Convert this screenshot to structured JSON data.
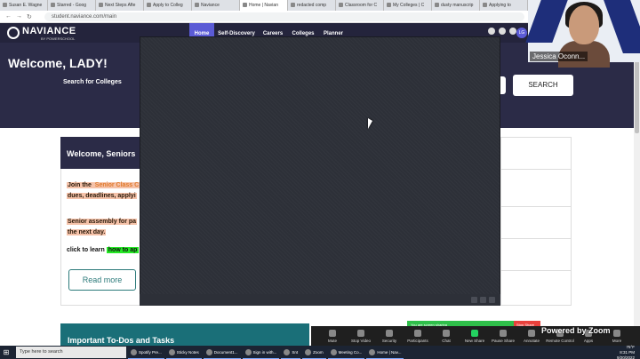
{
  "browser": {
    "tabs": [
      {
        "label": "Susan E. Wagne"
      },
      {
        "label": "Starred - Goog"
      },
      {
        "label": "Next Steps Afte"
      },
      {
        "label": "Apply to Colleg"
      },
      {
        "label": "Naviance"
      },
      {
        "label": "Home | Navian",
        "active": true
      },
      {
        "label": "redacted comp"
      },
      {
        "label": "Classroom for C"
      },
      {
        "label": "My Colleges | C"
      },
      {
        "label": "dusty manuscrip"
      },
      {
        "label": "Applying to"
      }
    ],
    "url": "student.naviance.com/main"
  },
  "naviance": {
    "logo": "NAVIANCE",
    "logo_sub": "BY POWERSCHOOL",
    "nav": [
      "Home",
      "Self-Discovery",
      "Careers",
      "Colleges",
      "Planner"
    ],
    "avatar": "LG",
    "welcome": "Welcome, LADY!",
    "search_label": "Search for Colleges",
    "search_button": "SEARCH"
  },
  "card": {
    "title": "Welcome, Seniors",
    "line1a": "Join the ",
    "line1b": "Senior Class C",
    "line2": "dues, deadlines, applyi",
    "line3": "Senior assembly for pa",
    "line4": "the next day.",
    "learn_prefix": "click to learn ",
    "learn_link": "how to ap",
    "read_more": "Read more"
  },
  "todo_title": "Important To-Dos and Tasks",
  "webcam": {
    "name": "Jessica Oconn..."
  },
  "zoom": {
    "sharing_banner": "You are screen sharing",
    "stop_share": "Stop Share",
    "powered": "Powered by Zoom",
    "controls": [
      {
        "label": "Mute"
      },
      {
        "label": "Stop Video"
      },
      {
        "label": "Security"
      },
      {
        "label": "Participants"
      },
      {
        "label": "Chat"
      },
      {
        "label": "New Share",
        "tone": "green"
      },
      {
        "label": "Pause Share"
      },
      {
        "label": "Annotate"
      },
      {
        "label": "Remote Control"
      },
      {
        "label": "Apps"
      },
      {
        "label": "More"
      }
    ]
  },
  "taskbar": {
    "search_placeholder": "Type here to search",
    "apps": [
      "Spotify Pre...",
      "Sticky Notes",
      "Document1...",
      "Sign in with...",
      "Snt",
      "Zoom",
      "Meeting Co...",
      "Home | Nav..."
    ],
    "weather": "75°F",
    "time": "8:31 PM",
    "date": "9/20/2022"
  }
}
